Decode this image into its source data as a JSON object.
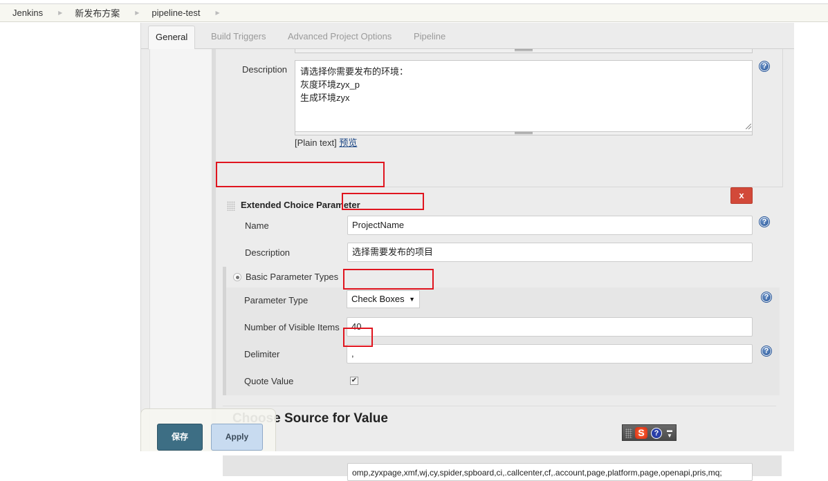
{
  "breadcrumb": {
    "items": [
      "Jenkins",
      "新发布方案",
      "pipeline-test"
    ],
    "separator_icon": "triangle-right-icon"
  },
  "tabs": [
    {
      "label": "General",
      "active": true
    },
    {
      "label": "Build Triggers",
      "active": false
    },
    {
      "label": "Advanced Project Options",
      "active": false
    },
    {
      "label": "Pipeline",
      "active": false
    }
  ],
  "previous_parameter": {
    "description_label": "Description",
    "description_value": "请选择你需要发布的环境：\n灰度环境zyx_p\n生成环境zyx",
    "format_text": "[Plain text]",
    "preview_link": "预览"
  },
  "extended_choice": {
    "title": "Extended Choice Parameter",
    "delete_label": "x",
    "name_label": "Name",
    "name_value": "ProjectName",
    "description_label": "Description",
    "description_value": "选择需要发布的项目",
    "basic_types_label": "Basic Parameter Types",
    "basic_types_selected": true,
    "parameter_type_label": "Parameter Type",
    "parameter_type_value": "Check Boxes",
    "visible_items_label": "Number of Visible Items",
    "visible_items_value": "40",
    "delimiter_label": "Delimiter",
    "delimiter_value": ",",
    "quote_value_label": "Quote Value",
    "quote_value_checked": true,
    "source_title": "Choose Source for Value",
    "value_field_partial": "omp,zyxpage,xmf,wj,cy,spider,spboard,ci,.callcenter,cf,.account,page,platform,page,openapi,pris,mq;"
  },
  "savebar": {
    "save_label": "保存",
    "apply_label": "Apply"
  },
  "ime_toolbar": {
    "logo": "S",
    "help": "?",
    "menu": "-▾"
  },
  "colors": {
    "delete_button": "#d24939",
    "save_button": "#3d6e84",
    "apply_button": "#c8dbf0",
    "highlight_box": "#e0141e",
    "help_icon": "#1f4f94"
  }
}
